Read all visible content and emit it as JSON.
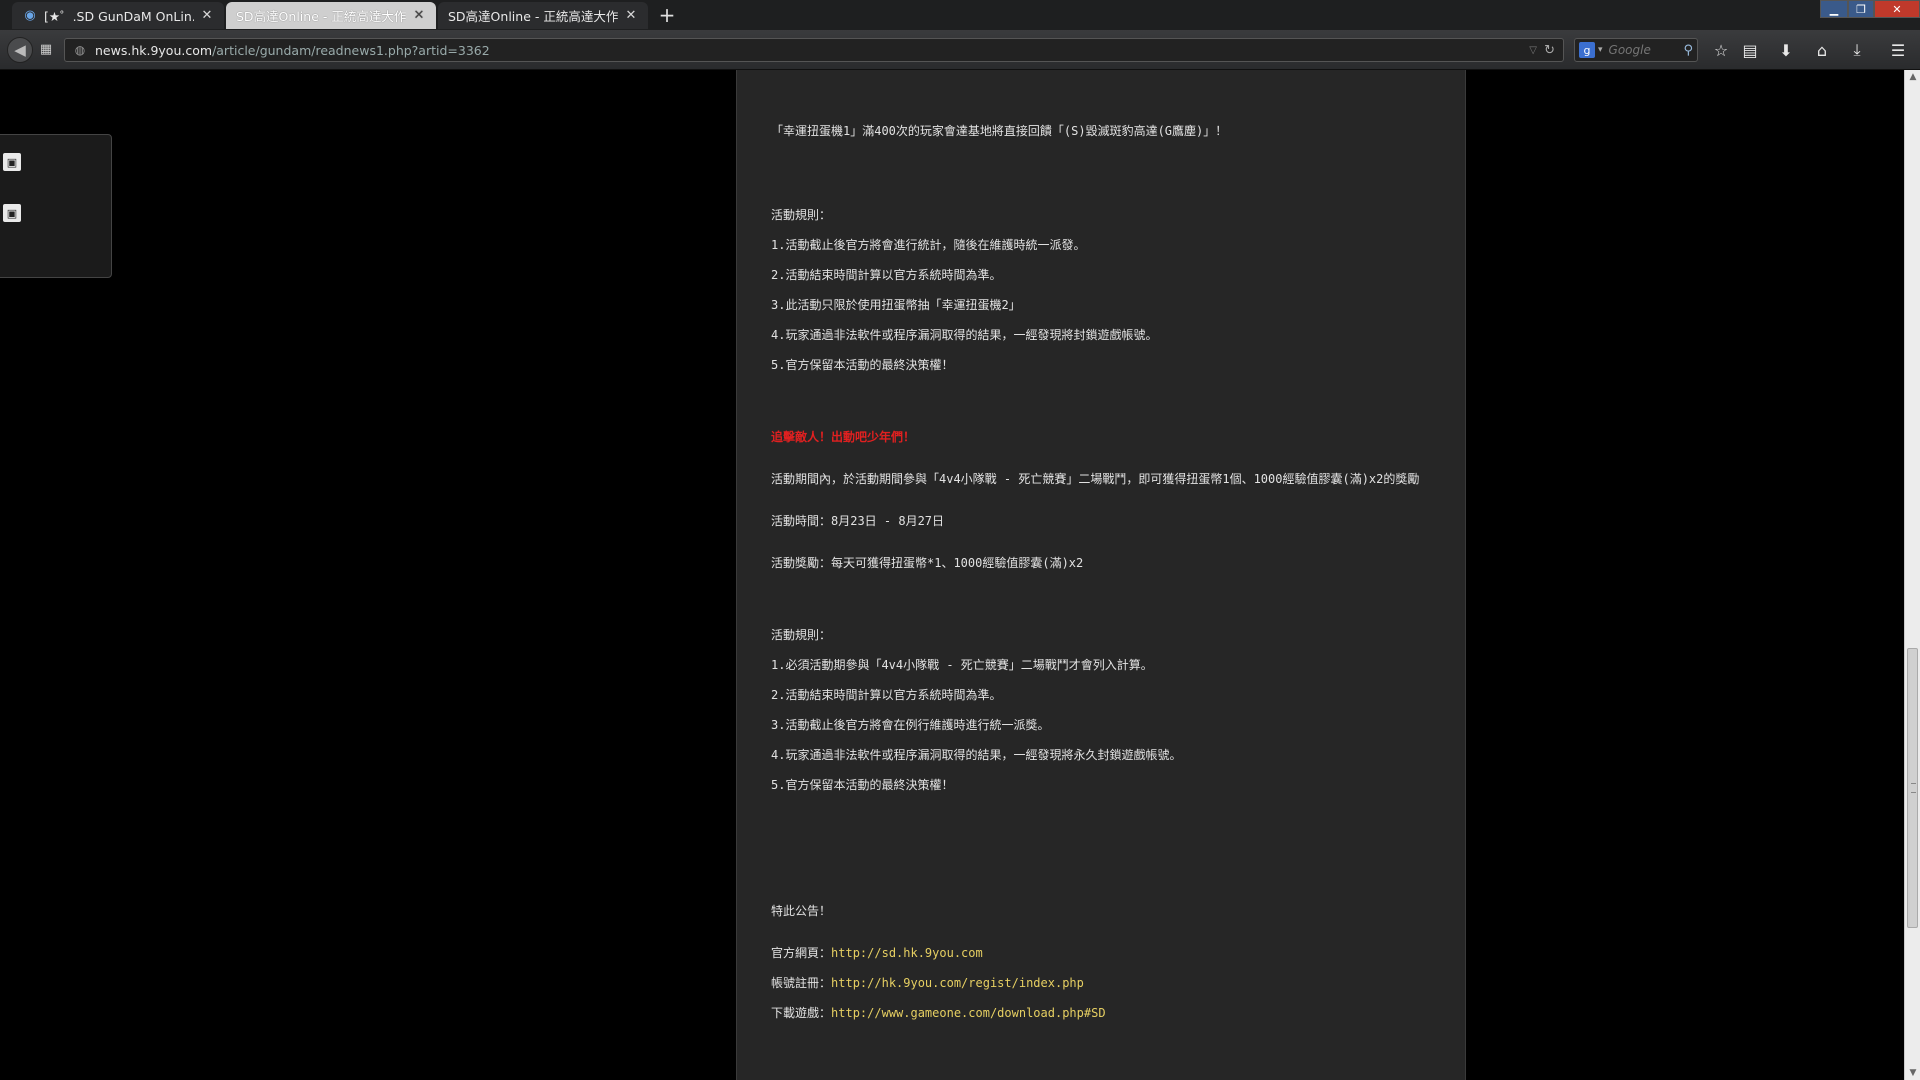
{
  "browser": {
    "tabs": [
      {
        "title": "[★゜.SD GunDaM OnLin...",
        "active": false
      },
      {
        "title": "SD高達Online - 正統高達大作",
        "active": true
      },
      {
        "title": "SD高達Online - 正統高達大作",
        "active": false
      }
    ],
    "url_host": "news.hk.9you.com",
    "url_path": "/article/gundam/readnews1.php?artid=3362",
    "search_placeholder": "Google",
    "icons": [
      "back-arrow-icon",
      "page-icon",
      "globe-icon",
      "reload-icon",
      "google-icon",
      "search-magnifier-icon",
      "star-icon",
      "reading-list-icon",
      "download-icon",
      "home-icon",
      "save-icon",
      "menu-icon"
    ]
  },
  "article": {
    "lines": [
      {
        "text": "「幸運扭蛋機1」滿400次的玩家會達基地將直接回饋「(S)毀滅斑豹高達(G鷹塵)」！"
      },
      {
        "text": "活動規則："
      },
      {
        "text": "1.活動截止後官方將會進行統計，隨後在維護時統一派發。"
      },
      {
        "text": "2.活動結束時間計算以官方系統時間為準。"
      },
      {
        "text": "3.此活動只限於使用扭蛋幣抽「幸運扭蛋機2」"
      },
      {
        "text": "4.玩家通過非法軟件或程序漏洞取得的結果，一經發現將封鎖遊戲帳號。"
      },
      {
        "text": "5.官方保留本活動的最終決策權！"
      },
      {
        "text": "追擊敵人！出動吧少年們！"
      },
      {
        "text": "活動期間內，於活動期間參與「4v4小隊戰 - 死亡競賽」二場戰鬥，即可獲得扭蛋幣1個、1000經驗值膠囊(滿)x2的獎勵"
      },
      {
        "text": "活動時間：8月23日 - 8月27日"
      },
      {
        "text": "活動獎勵：每天可獲得扭蛋幣*1、1000經驗值膠囊(滿)x2"
      },
      {
        "text": "活動規則："
      },
      {
        "text": "1.必須活動期參與「4v4小隊戰 - 死亡競賽」二場戰鬥才會列入計算。"
      },
      {
        "text": "2.活動結束時間計算以官方系統時間為準。"
      },
      {
        "text": "3.活動截止後官方將會在例行維護時進行統一派獎。"
      },
      {
        "text": "4.玩家通過非法軟件或程序漏洞取得的結果，一經發現將永久封鎖遊戲帳號。"
      },
      {
        "text": "5.官方保留本活動的最終決策權！"
      },
      {
        "text": "特此公告！"
      }
    ],
    "links": [
      {
        "label": "官方網頁：",
        "url": "http://sd.hk.9you.com"
      },
      {
        "label": "帳號註冊：",
        "url": "http://hk.9you.com/regist/index.php"
      },
      {
        "label": "下載遊戲：",
        "url": "http://www.gameone.com/download.php#SD"
      }
    ],
    "highlight_color": "#e02020",
    "link_color": "#e6cf62"
  }
}
